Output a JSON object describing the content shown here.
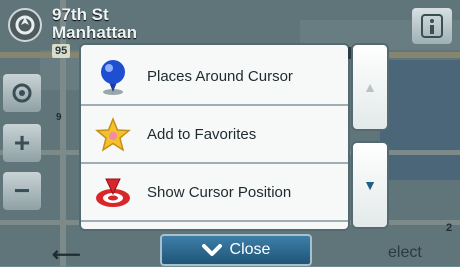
{
  "street": {
    "name": "97th St\nManhattan",
    "route_shield": "95"
  },
  "map_labels": [
    "9"
  ],
  "menu": {
    "items": [
      {
        "label": "Places Around Cursor",
        "icon": "blue-pin-icon"
      },
      {
        "label": "Add to Favorites",
        "icon": "favorites-star-icon"
      },
      {
        "label": "Show Cursor Position",
        "icon": "cursor-position-icon"
      }
    ]
  },
  "scroll": {
    "up_icon": "triangle-up-icon",
    "down_icon": "triangle-down-icon"
  },
  "close_button": {
    "label": "Close",
    "icon": "chevron-down-icon"
  },
  "bottom": {
    "select_label": "elect",
    "side_number": "2"
  },
  "colors": {
    "accent": "#2a6a93",
    "menu_bg": "#f7f9f9",
    "border": "#546a70"
  }
}
